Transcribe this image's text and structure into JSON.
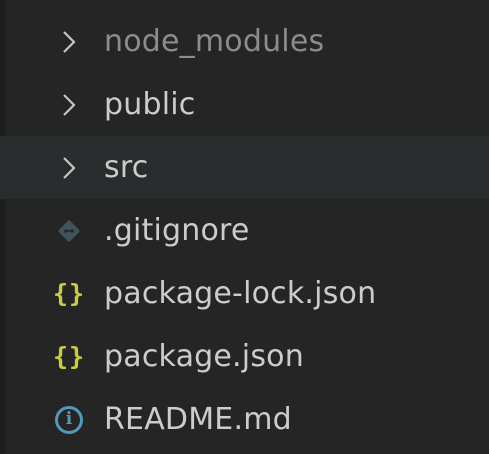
{
  "explorer": {
    "items": [
      {
        "type": "folder",
        "label": "node_modules",
        "icon": "chevron-right-icon",
        "dimmed": true
      },
      {
        "type": "folder",
        "label": "public",
        "icon": "chevron-right-icon"
      },
      {
        "type": "folder",
        "label": "src",
        "icon": "chevron-right-icon",
        "hovered": true
      },
      {
        "type": "file",
        "label": ".gitignore",
        "icon": "git-icon"
      },
      {
        "type": "file",
        "label": "package-lock.json",
        "icon": "json-icon",
        "icon_text": "{}"
      },
      {
        "type": "file",
        "label": "package.json",
        "icon": "json-icon",
        "icon_text": "{}"
      },
      {
        "type": "file",
        "label": "README.md",
        "icon": "info-icon",
        "icon_text": "i"
      }
    ]
  },
  "colors": {
    "background": "#252526",
    "hover": "#2a2d2e",
    "text": "#cccccc",
    "dimmed_text": "#8c8c8c",
    "json_icon": "#cbcb41",
    "info_icon": "#519aba",
    "git_icon": "#41535b"
  }
}
